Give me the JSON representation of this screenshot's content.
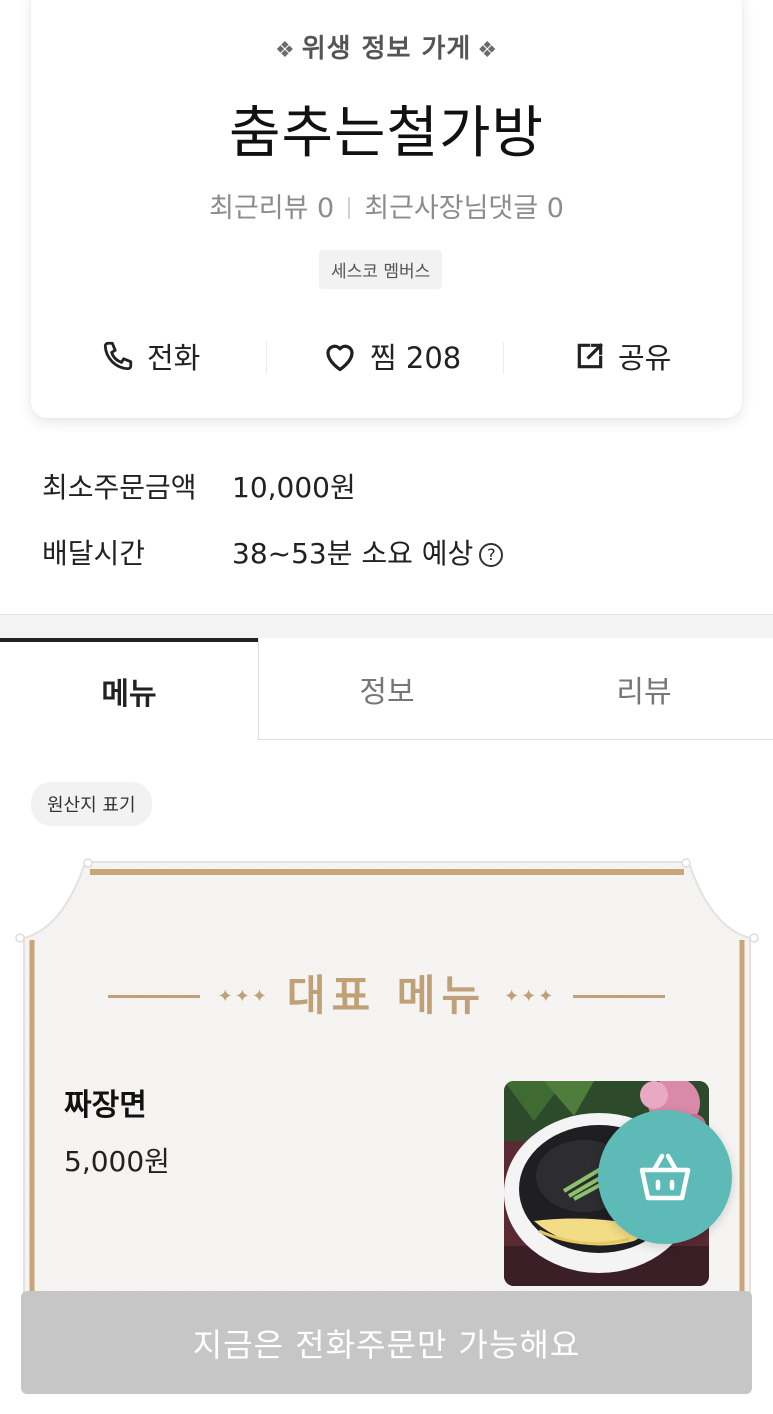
{
  "store": {
    "hygiene_label": "위생 정보 가게",
    "name": "춤추는철가방",
    "recent_reviews": "최근리뷰 0",
    "recent_owner_comments": "최근사장님댓글 0",
    "member_badge": "세스코 멤버스"
  },
  "actions": {
    "call": "전화",
    "like": "찜 208",
    "share": "공유"
  },
  "info": {
    "min_order_label": "최소주문금액",
    "min_order_value": "10,000원",
    "delivery_time_label": "배달시간",
    "delivery_time_value": "38~53분 소요 예상",
    "help_glyph": "?"
  },
  "tabs": [
    {
      "label": "메뉴",
      "active": true
    },
    {
      "label": "정보",
      "active": false
    },
    {
      "label": "리뷰",
      "active": false
    }
  ],
  "origin_chip": "원산지 표기",
  "featured": {
    "title": "대표 메뉴",
    "items": [
      {
        "name": "짜장면",
        "price": "5,000원"
      }
    ]
  },
  "order_bar": "지금은 전화주문만 가능해요",
  "colors": {
    "accent_teal": "#5dbab7",
    "frame_gold": "#c0a076",
    "disabled_gray": "#c6c6c6"
  }
}
